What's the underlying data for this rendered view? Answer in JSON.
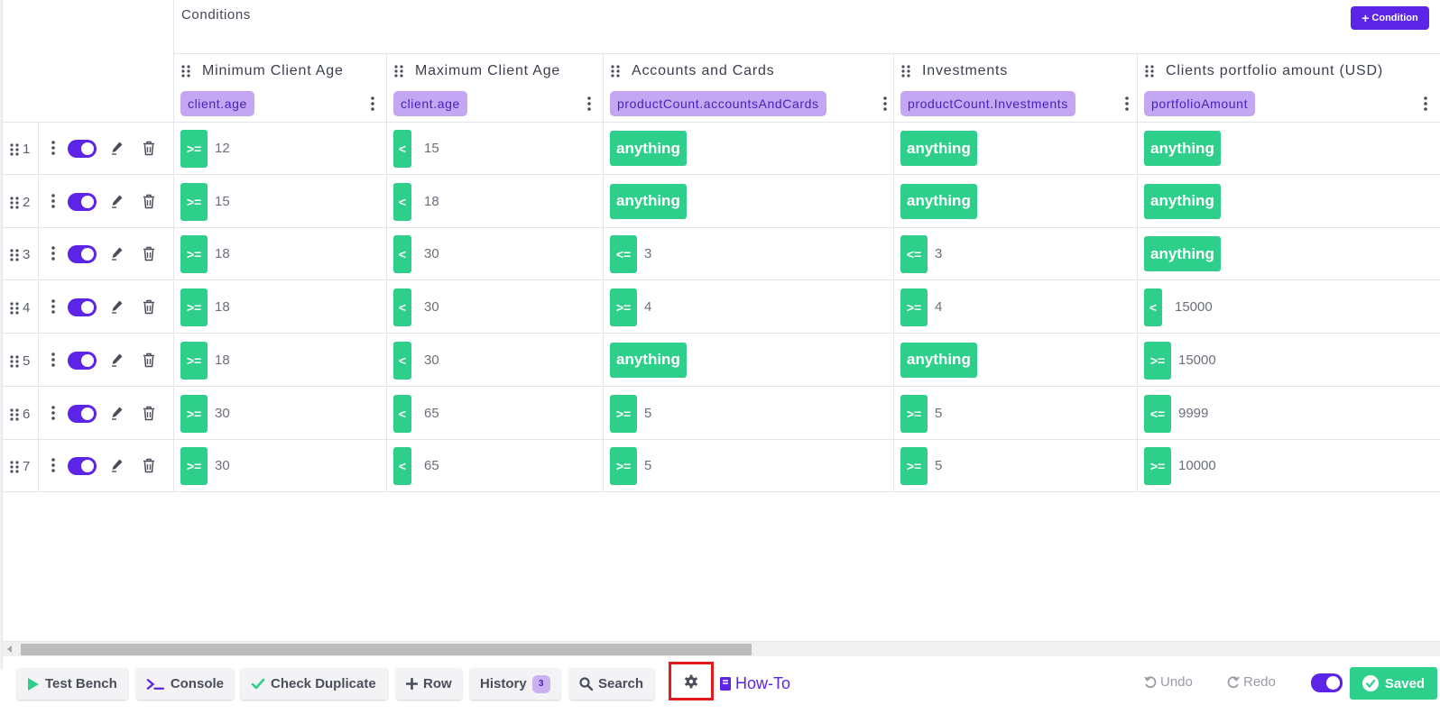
{
  "header": {
    "title": "Conditions",
    "add_condition_label": "Condition"
  },
  "columns": [
    {
      "name": "Minimum Client Age",
      "expression": "client.age"
    },
    {
      "name": "Maximum Client Age",
      "expression": "client.age"
    },
    {
      "name": "Accounts and Cards",
      "expression": "productCount.accountsAndCards"
    },
    {
      "name": "Investments",
      "expression": "productCount.Investments"
    },
    {
      "name": "Clients portfolio amount (USD)",
      "expression": "portfolioAmount"
    }
  ],
  "rows": [
    {
      "number": "1",
      "enabled": true,
      "cells": [
        {
          "op": ">=",
          "value": "12"
        },
        {
          "op": "<",
          "value": "15"
        },
        {
          "op": "anything",
          "value": ""
        },
        {
          "op": "anything",
          "value": ""
        },
        {
          "op": "anything",
          "value": ""
        }
      ]
    },
    {
      "number": "2",
      "enabled": true,
      "cells": [
        {
          "op": ">=",
          "value": "15"
        },
        {
          "op": "<",
          "value": "18"
        },
        {
          "op": "anything",
          "value": ""
        },
        {
          "op": "anything",
          "value": ""
        },
        {
          "op": "anything",
          "value": ""
        }
      ]
    },
    {
      "number": "3",
      "enabled": true,
      "cells": [
        {
          "op": ">=",
          "value": "18"
        },
        {
          "op": "<",
          "value": "30"
        },
        {
          "op": "<=",
          "value": "3"
        },
        {
          "op": "<=",
          "value": "3"
        },
        {
          "op": "anything",
          "value": ""
        }
      ]
    },
    {
      "number": "4",
      "enabled": true,
      "cells": [
        {
          "op": ">=",
          "value": "18"
        },
        {
          "op": "<",
          "value": "30"
        },
        {
          "op": ">=",
          "value": "4"
        },
        {
          "op": ">=",
          "value": "4"
        },
        {
          "op": "<",
          "value": "15000"
        }
      ]
    },
    {
      "number": "5",
      "enabled": true,
      "cells": [
        {
          "op": ">=",
          "value": "18"
        },
        {
          "op": "<",
          "value": "30"
        },
        {
          "op": "anything",
          "value": ""
        },
        {
          "op": "anything",
          "value": ""
        },
        {
          "op": ">=",
          "value": "15000"
        }
      ]
    },
    {
      "number": "6",
      "enabled": true,
      "cells": [
        {
          "op": ">=",
          "value": "30"
        },
        {
          "op": "<",
          "value": "65"
        },
        {
          "op": ">=",
          "value": "5"
        },
        {
          "op": ">=",
          "value": "5"
        },
        {
          "op": "<=",
          "value": "9999"
        }
      ]
    },
    {
      "number": "7",
      "enabled": true,
      "cells": [
        {
          "op": ">=",
          "value": "30"
        },
        {
          "op": "<",
          "value": "65"
        },
        {
          "op": ">=",
          "value": "5"
        },
        {
          "op": ">=",
          "value": "5"
        },
        {
          "op": ">=",
          "value": "10000"
        }
      ]
    }
  ],
  "footer": {
    "test_bench": "Test Bench",
    "console": "Console",
    "check_duplicate": "Check Duplicate",
    "row": "Row",
    "history": "History",
    "history_count": "3",
    "search": "Search",
    "how_to": "How-To",
    "undo": "Undo",
    "redo": "Redo",
    "saved": "Saved",
    "autosave_enabled": true
  },
  "colors": {
    "accent": "#5b24e6",
    "operator": "#2ecf8a",
    "expression_chip": "#c4a7f3",
    "highlight_box": "#e11b1b"
  },
  "icons": [
    "drag-handle-icon",
    "kebab-icon",
    "pencil-icon",
    "trash-icon",
    "play-icon",
    "terminal-icon",
    "check-icon",
    "plus-icon",
    "search-icon",
    "gear-icon",
    "book-icon",
    "undo-icon",
    "redo-icon"
  ]
}
